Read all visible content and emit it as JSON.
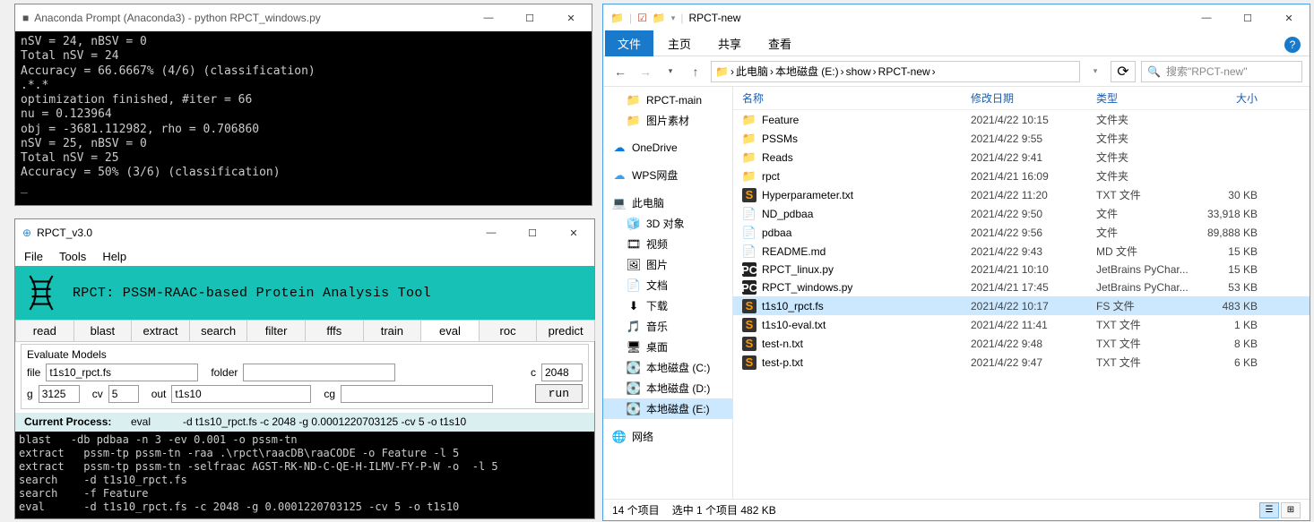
{
  "anaconda": {
    "title": "Anaconda Prompt (Anaconda3) - python  RPCT_windows.py",
    "icon": "■",
    "lines": [
      "nSV = 24, nBSV = 0",
      "Total nSV = 24",
      "Accuracy = 66.6667% (4/6) (classification)",
      ".*.*",
      "optimization finished, #iter = 66",
      "nu = 0.123964",
      "obj = -3681.112982, rho = 0.706860",
      "nSV = 25, nBSV = 0",
      "Total nSV = 25",
      "Accuracy = 50% (3/6) (classification)",
      "_"
    ]
  },
  "rpct": {
    "title": "RPCT_v3.0",
    "menus": [
      "File",
      "Tools",
      "Help"
    ],
    "banner": "RPCT: PSSM-RAAC-based Protein Analysis Tool",
    "tabs": [
      "read",
      "blast",
      "extract",
      "search",
      "filter",
      "fffs",
      "train",
      "eval",
      "roc",
      "predict"
    ],
    "active_tab": "eval",
    "form_title": "Evaluate Models",
    "labels": {
      "file": "file",
      "folder": "folder",
      "c": "c",
      "g": "g",
      "cv": "cv",
      "out": "out",
      "cg": "cg"
    },
    "values": {
      "file": "t1s10_rpct.fs",
      "folder": "",
      "c": "2048",
      "g": "3125",
      "cv": "5",
      "out": "t1s10",
      "cg": ""
    },
    "run": "run",
    "process_label": "Current Process:",
    "process_cmd": "eval",
    "process_args": "-d t1s10_rpct.fs -c 2048 -g 0.0001220703125 -cv 5 -o t1s10",
    "log": [
      "blast   -db pdbaa -n 3 -ev 0.001 -o pssm-tn",
      "extract   pssm-tp pssm-tn -raa .\\rpct\\raacDB\\raaCODE -o Feature -l 5",
      "extract   pssm-tp pssm-tn -selfraac AGST-RK-ND-C-QE-H-ILMV-FY-P-W -o  -l 5",
      "search    -d t1s10_rpct.fs",
      "search    -f Feature",
      "eval      -d t1s10_rpct.fs -c 2048 -g 0.0001220703125 -cv 5 -o t1s10"
    ]
  },
  "explorer": {
    "title": "RPCT-new",
    "ribbon": {
      "file": "文件",
      "home": "主页",
      "share": "共享",
      "view": "查看"
    },
    "breadcrumb": [
      "此电脑",
      "本地磁盘 (E:)",
      "show",
      "RPCT-new"
    ],
    "search_placeholder": "搜索\"RPCT-new\"",
    "nav": {
      "quick": [
        {
          "icon": "📁",
          "label": "RPCT-main"
        },
        {
          "icon": "📁",
          "label": "图片素材"
        }
      ],
      "cloud": [
        {
          "icon": "☁",
          "label": "OneDrive",
          "color": "#0a7bd6"
        },
        {
          "icon": "☁",
          "label": "WPS网盘",
          "color": "#3aa0f0"
        }
      ],
      "pc_label": "此电脑",
      "pc": [
        {
          "icon": "🧊",
          "label": "3D 对象"
        },
        {
          "icon": "🎞",
          "label": "视频"
        },
        {
          "icon": "🖼",
          "label": "图片"
        },
        {
          "icon": "📄",
          "label": "文档"
        },
        {
          "icon": "⬇",
          "label": "下载"
        },
        {
          "icon": "🎵",
          "label": "音乐"
        },
        {
          "icon": "🖥",
          "label": "桌面"
        },
        {
          "icon": "💽",
          "label": "本地磁盘 (C:)"
        },
        {
          "icon": "💽",
          "label": "本地磁盘 (D:)"
        },
        {
          "icon": "💽",
          "label": "本地磁盘 (E:)",
          "active": true
        }
      ],
      "network": {
        "icon": "🌐",
        "label": "网络"
      }
    },
    "columns": {
      "name": "名称",
      "date": "修改日期",
      "type": "类型",
      "size": "大小"
    },
    "files": [
      {
        "icon": "folder",
        "name": "Feature",
        "date": "2021/4/22 10:15",
        "type": "文件夹",
        "size": ""
      },
      {
        "icon": "folder",
        "name": "PSSMs",
        "date": "2021/4/22 9:55",
        "type": "文件夹",
        "size": ""
      },
      {
        "icon": "folder",
        "name": "Reads",
        "date": "2021/4/22 9:41",
        "type": "文件夹",
        "size": ""
      },
      {
        "icon": "folder",
        "name": "rpct",
        "date": "2021/4/21 16:09",
        "type": "文件夹",
        "size": ""
      },
      {
        "icon": "s",
        "name": "Hyperparameter.txt",
        "date": "2021/4/22 11:20",
        "type": "TXT 文件",
        "size": "30 KB"
      },
      {
        "icon": "file",
        "name": "ND_pdbaa",
        "date": "2021/4/22 9:50",
        "type": "文件",
        "size": "33,918 KB"
      },
      {
        "icon": "file",
        "name": "pdbaa",
        "date": "2021/4/22 9:56",
        "type": "文件",
        "size": "89,888 KB"
      },
      {
        "icon": "file",
        "name": "README.md",
        "date": "2021/4/22 9:43",
        "type": "MD 文件",
        "size": "15 KB"
      },
      {
        "icon": "pc",
        "name": "RPCT_linux.py",
        "date": "2021/4/21 10:10",
        "type": "JetBrains PyChar...",
        "size": "15 KB"
      },
      {
        "icon": "pc",
        "name": "RPCT_windows.py",
        "date": "2021/4/21 17:45",
        "type": "JetBrains PyChar...",
        "size": "53 KB"
      },
      {
        "icon": "s",
        "name": "t1s10_rpct.fs",
        "date": "2021/4/22 10:17",
        "type": "FS 文件",
        "size": "483 KB",
        "selected": true
      },
      {
        "icon": "s",
        "name": "t1s10-eval.txt",
        "date": "2021/4/22 11:41",
        "type": "TXT 文件",
        "size": "1 KB"
      },
      {
        "icon": "s",
        "name": "test-n.txt",
        "date": "2021/4/22 9:48",
        "type": "TXT 文件",
        "size": "8 KB"
      },
      {
        "icon": "s",
        "name": "test-p.txt",
        "date": "2021/4/22 9:47",
        "type": "TXT 文件",
        "size": "6 KB"
      }
    ],
    "status": {
      "count": "14 个项目",
      "selected": "选中 1 个项目  482 KB"
    }
  }
}
